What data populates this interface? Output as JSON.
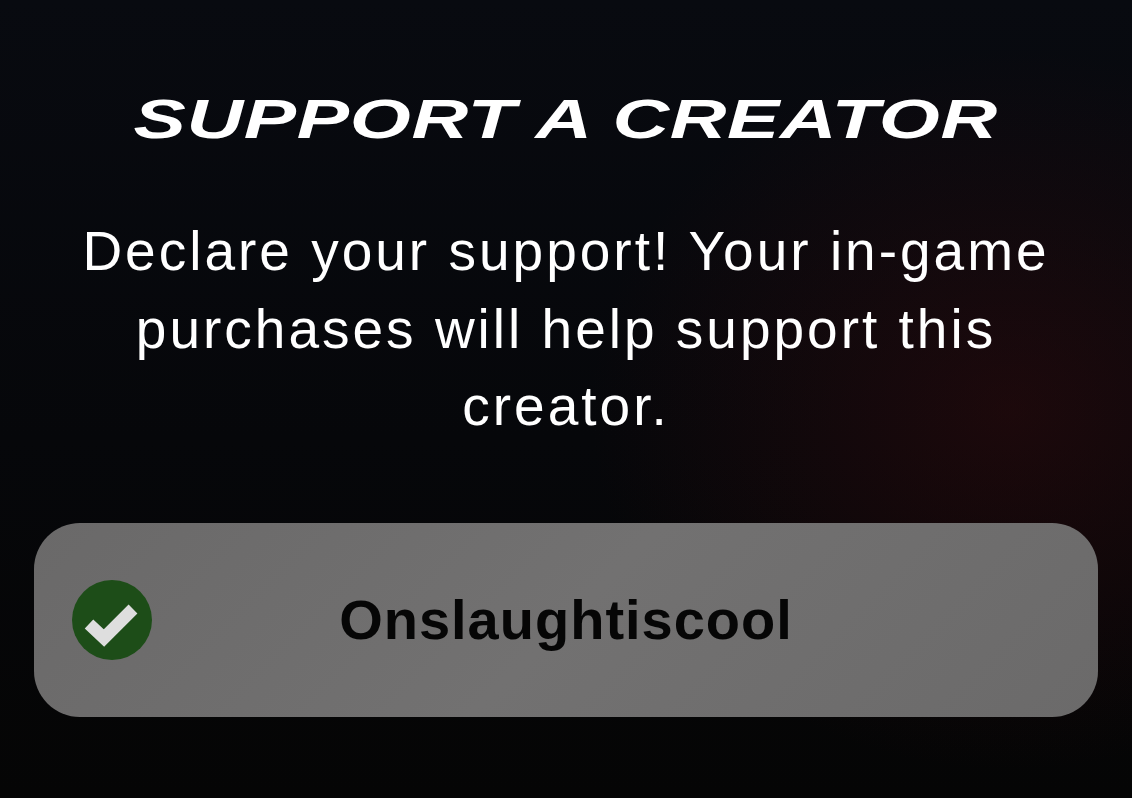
{
  "title": "SUPPORT A CREATOR",
  "description": "Declare your support! Your in-game purchases will help support this creator.",
  "creator": {
    "name": "Onslaughtiscool",
    "selected": true
  }
}
